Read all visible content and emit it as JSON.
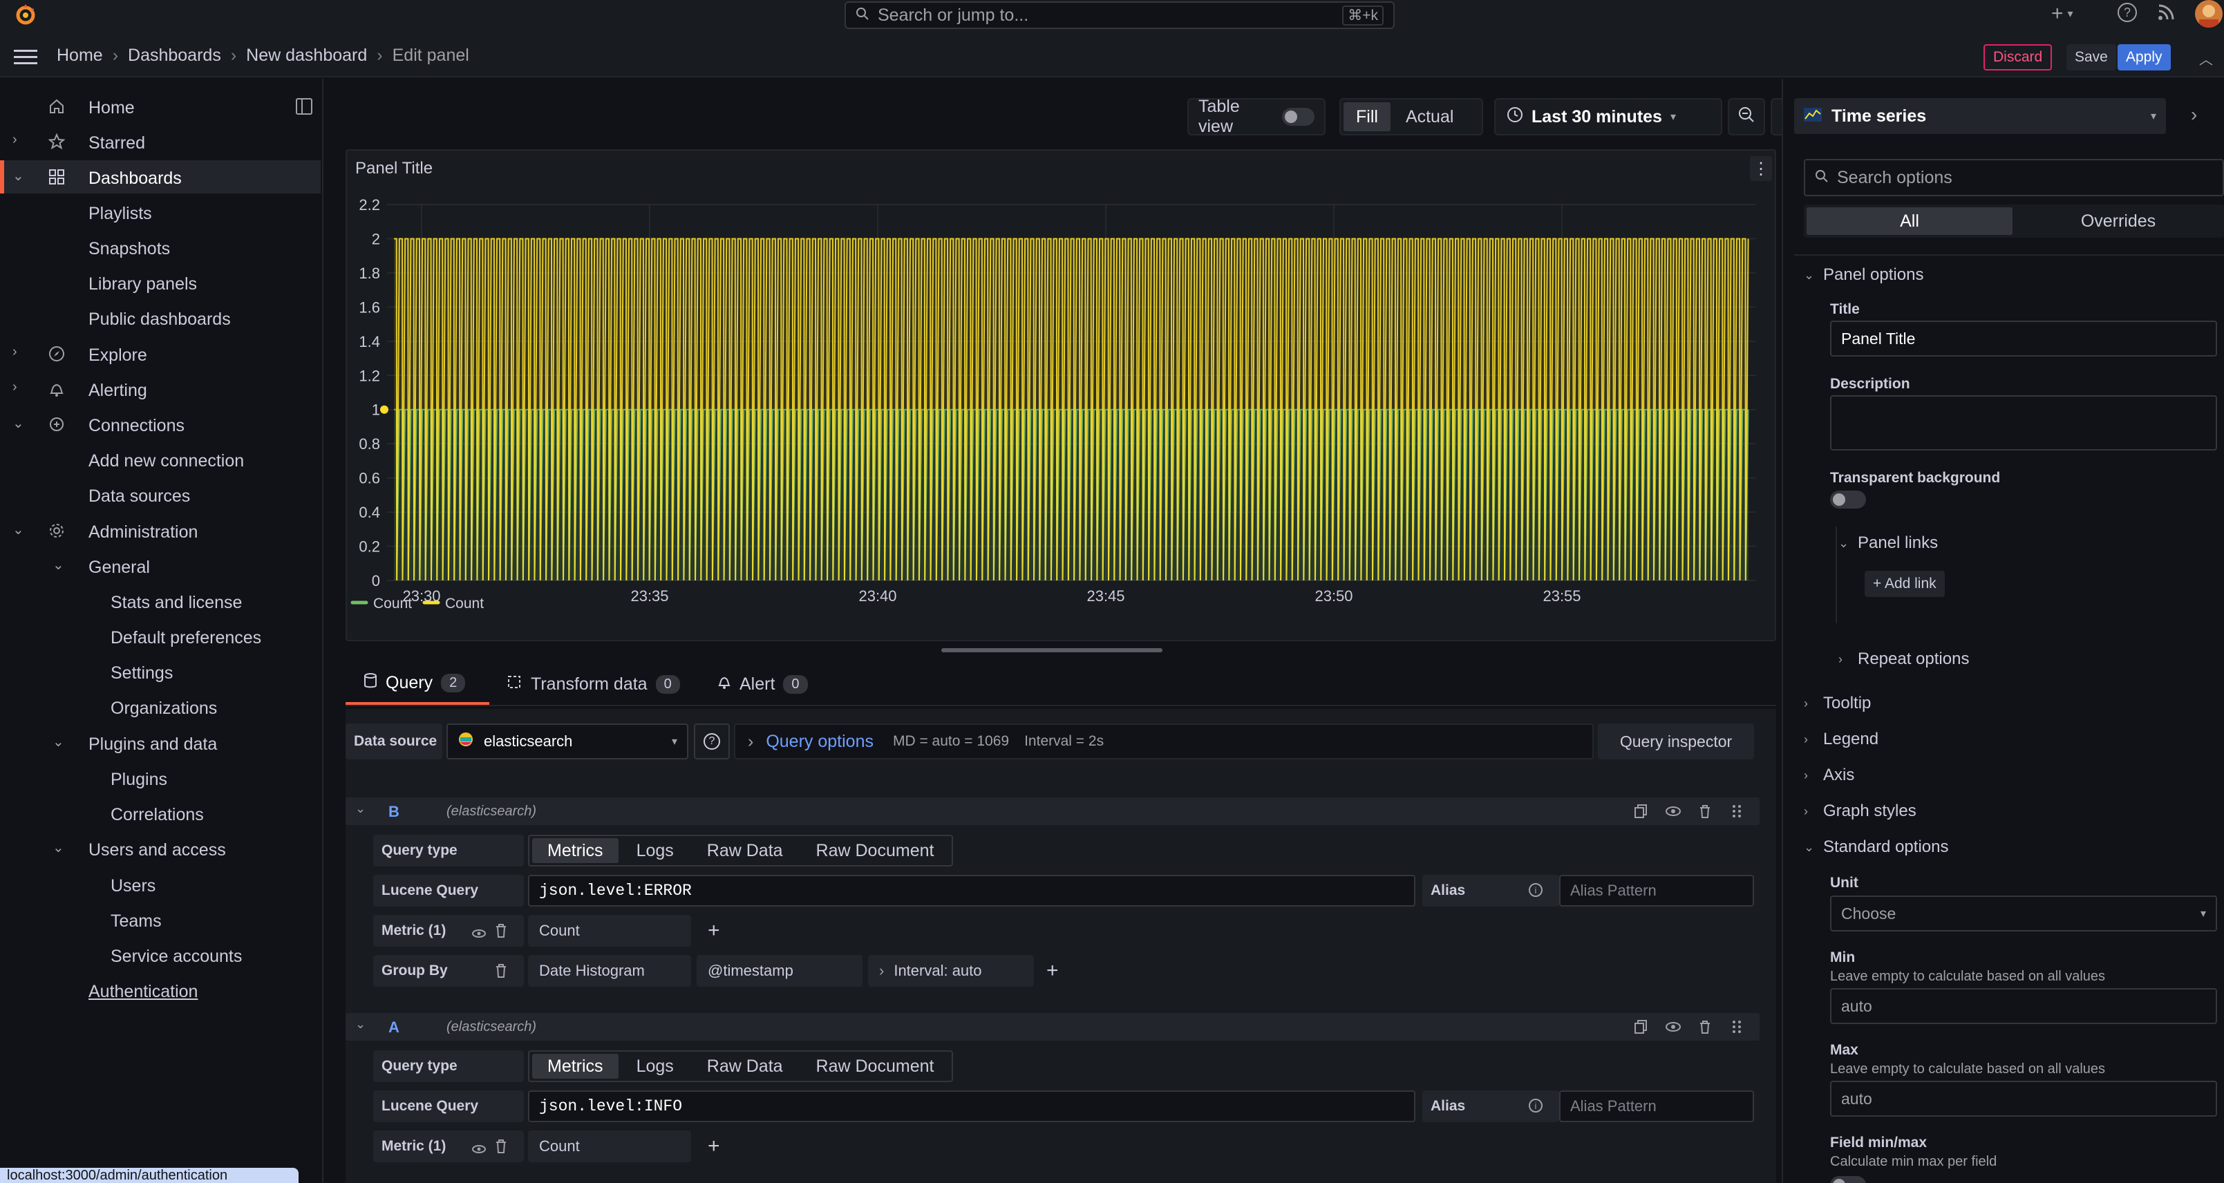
{
  "topbar": {
    "search_placeholder": "Search or jump to...",
    "search_shortcut": "⌘+k",
    "plus": "+"
  },
  "breadcrumb": {
    "items": [
      "Home",
      "Dashboards",
      "New dashboard"
    ],
    "current": "Edit panel",
    "sep": "›"
  },
  "actions": {
    "discard": "Discard",
    "save": "Save",
    "apply": "Apply"
  },
  "sidebar": {
    "items": [
      {
        "label": "Home"
      },
      {
        "label": "Starred"
      },
      {
        "label": "Dashboards"
      },
      {
        "label": "Playlists"
      },
      {
        "label": "Snapshots"
      },
      {
        "label": "Library panels"
      },
      {
        "label": "Public dashboards"
      },
      {
        "label": "Explore"
      },
      {
        "label": "Alerting"
      },
      {
        "label": "Connections"
      },
      {
        "label": "Add new connection"
      },
      {
        "label": "Data sources"
      },
      {
        "label": "Administration"
      },
      {
        "label": "General"
      },
      {
        "label": "Stats and license"
      },
      {
        "label": "Default preferences"
      },
      {
        "label": "Settings"
      },
      {
        "label": "Organizations"
      },
      {
        "label": "Plugins and data"
      },
      {
        "label": "Plugins"
      },
      {
        "label": "Correlations"
      },
      {
        "label": "Users and access"
      },
      {
        "label": "Users"
      },
      {
        "label": "Teams"
      },
      {
        "label": "Service accounts"
      },
      {
        "label": "Authentication"
      }
    ]
  },
  "status_url": "localhost:3000/admin/authentication",
  "toolbar": {
    "table_view": "Table view",
    "fill": "Fill",
    "actual": "Actual",
    "time_range": "Last 30 minutes"
  },
  "panel": {
    "title": "Panel Title",
    "menu": "⋮"
  },
  "chart_data": {
    "type": "line",
    "title": "Panel Title",
    "x": [
      "23:30",
      "23:35",
      "23:40",
      "23:45",
      "23:50",
      "23:55"
    ],
    "y_ticks": [
      "0",
      "0.2",
      "0.4",
      "0.6",
      "0.8",
      "1",
      "1.2",
      "1.4",
      "1.6",
      "1.8",
      "2",
      "2.2"
    ],
    "ylim": [
      0,
      2.2
    ],
    "series": [
      {
        "name": "Count",
        "color": "#73bf69",
        "value_pattern": [
          0,
          1
        ]
      },
      {
        "name": "Count",
        "color": "#fade2a",
        "value_pattern": [
          0,
          2
        ]
      }
    ],
    "legend": "bottom-left"
  },
  "tabs": [
    {
      "label": "Query",
      "count": "2"
    },
    {
      "label": "Transform data",
      "count": "0"
    },
    {
      "label": "Alert",
      "count": "0"
    }
  ],
  "ds": {
    "label": "Data source",
    "value": "elasticsearch",
    "query_options": "Query options",
    "md": "MD = auto = 1069",
    "interval": "Interval = 2s",
    "inspector": "Query inspector"
  },
  "queries": [
    {
      "ref": "B",
      "ds": "(elasticsearch)",
      "query_type": "Query type",
      "types": [
        "Metrics",
        "Logs",
        "Raw Data",
        "Raw Document"
      ],
      "lucene_label": "Lucene Query",
      "lucene": "json.level:ERROR",
      "alias_label": "Alias",
      "alias_placeholder": "Alias Pattern",
      "metric_label": "Metric (1)",
      "metric": "Count",
      "groupby_label": "Group By",
      "groupby": "Date Histogram",
      "field": "@timestamp",
      "interval": "Interval: auto"
    },
    {
      "ref": "A",
      "ds": "(elasticsearch)",
      "query_type": "Query type",
      "types": [
        "Metrics",
        "Logs",
        "Raw Data",
        "Raw Document"
      ],
      "lucene_label": "Lucene Query",
      "lucene": "json.level:INFO",
      "alias_label": "Alias",
      "alias_placeholder": "Alias Pattern",
      "metric_label": "Metric (1)",
      "metric": "Count"
    }
  ],
  "options": {
    "viz": "Time series",
    "search_placeholder": "Search options",
    "all": "All",
    "overrides": "Overrides",
    "panel_options": "Panel options",
    "title_label": "Title",
    "title_value": "Panel Title",
    "description_label": "Description",
    "transparent": "Transparent background",
    "panel_links": "Panel links",
    "add_link": "+ Add link",
    "repeat": "Repeat options",
    "tooltip": "Tooltip",
    "legend": "Legend",
    "axis": "Axis",
    "graph_styles": "Graph styles",
    "standard": "Standard options",
    "unit_label": "Unit",
    "unit_value": "Choose",
    "min_label": "Min",
    "min_desc": "Leave empty to calculate based on all values",
    "min_value": "auto",
    "max_label": "Max",
    "max_desc": "Leave empty to calculate based on all values",
    "max_value": "auto",
    "fieldminmax_label": "Field min/max",
    "fieldminmax_desc": "Calculate min max per field"
  }
}
